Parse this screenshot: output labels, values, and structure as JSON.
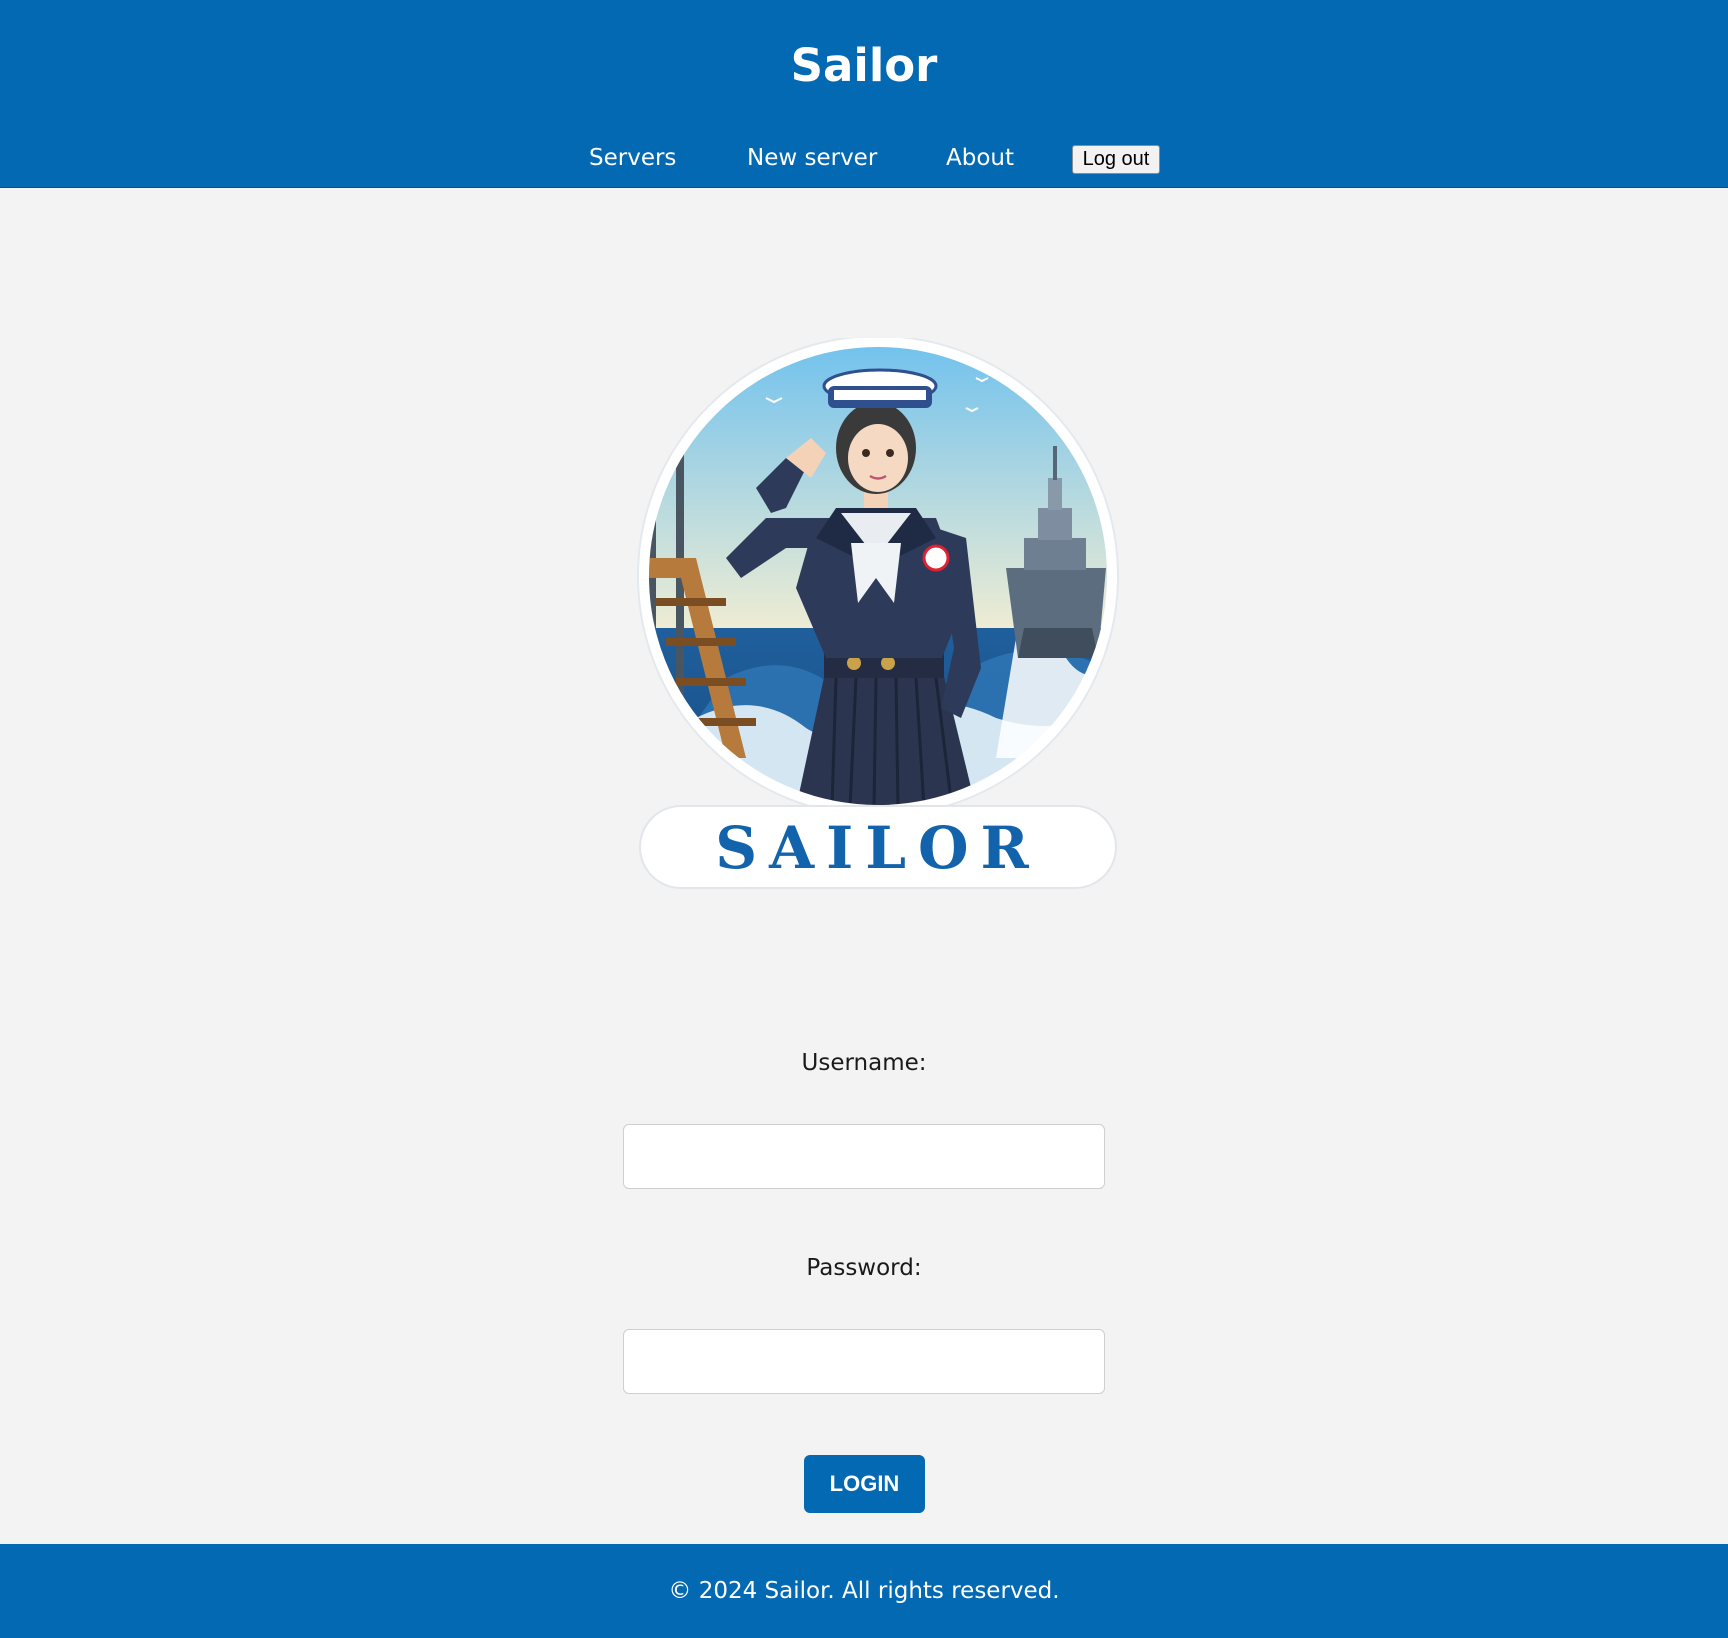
{
  "header": {
    "title": "Sailor",
    "nav": {
      "servers": "Servers",
      "new_server": "New server",
      "about": "About",
      "logout": "Log out"
    }
  },
  "logo": {
    "wordmark": "SAILOR",
    "icon": "sailor-logo"
  },
  "form": {
    "username_label": "Username:",
    "username_value": "",
    "password_label": "Password:",
    "password_value": "",
    "login_label": "LOGIN"
  },
  "footer": {
    "text": "© 2024 Sailor. All rights reserved."
  },
  "colors": {
    "brand": "#0369b3",
    "background": "#f3f3f3"
  }
}
